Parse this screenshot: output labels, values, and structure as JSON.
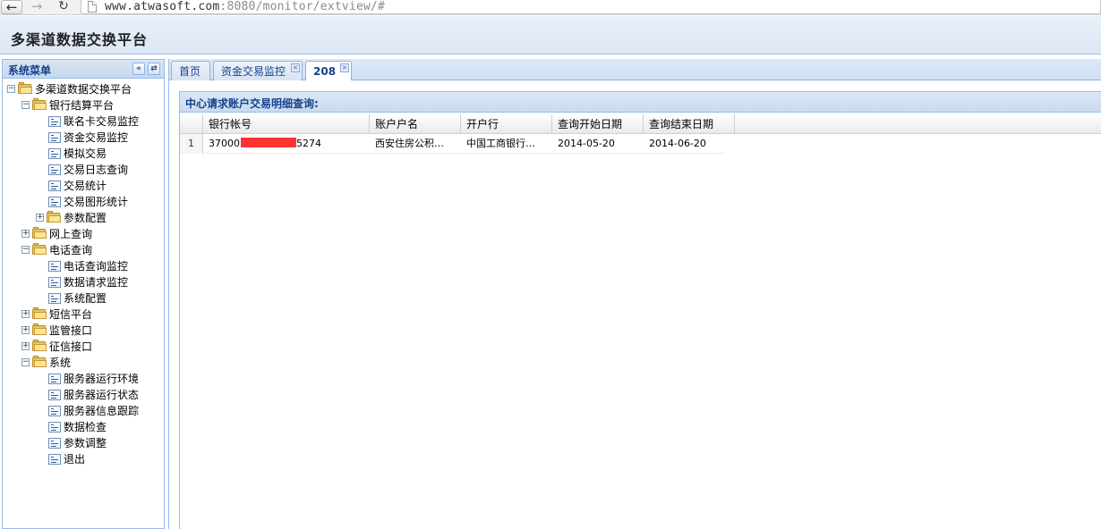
{
  "browser": {
    "url_host": "www.atwasoft.com",
    "url_rest": ":8080/monitor/extview/#"
  },
  "app": {
    "title": "多渠道数据交换平台"
  },
  "sidebar": {
    "title": "系统菜单",
    "tree": {
      "root": "多渠道数据交换平台",
      "bank_settlement": "银行结算平台",
      "bank_items": [
        "联名卡交易监控",
        "资金交易监控",
        "模拟交易",
        "交易日志查询",
        "交易统计",
        "交易图形统计"
      ],
      "param_config": "参数配置",
      "online_query": "网上查询",
      "phone_query": "电话查询",
      "phone_items": [
        "电话查询监控",
        "数据请求监控",
        "系统配置"
      ],
      "sms": "短信平台",
      "supervision": "监管接口",
      "credit": "征信接口",
      "system": "系统",
      "system_items": [
        "服务器运行环境",
        "服务器运行状态",
        "服务器信息跟踪",
        "数据检查",
        "参数调整",
        "退出"
      ]
    }
  },
  "tabs": [
    {
      "label": "首页",
      "closable": false,
      "active": false
    },
    {
      "label": "资金交易监控",
      "closable": true,
      "active": false
    },
    {
      "label": "208",
      "closable": true,
      "active": true
    }
  ],
  "grid": {
    "title": "中心请求账户交易明细查询:",
    "columns": [
      "银行帐号",
      "账户户名",
      "开户行",
      "查询开始日期",
      "查询结束日期"
    ],
    "rows": [
      {
        "row_number": "1",
        "account_prefix": "37000",
        "account_suffix": "5274",
        "account_name": "西安住房公积…",
        "bank": "中国工商银行…",
        "start_date": "2014-05-20",
        "end_date": "2014-06-20"
      }
    ]
  },
  "colors": {
    "accent": "#15428b",
    "border": "#99bbe8",
    "redaction": "#ff3333",
    "folder": "#e8c567"
  }
}
